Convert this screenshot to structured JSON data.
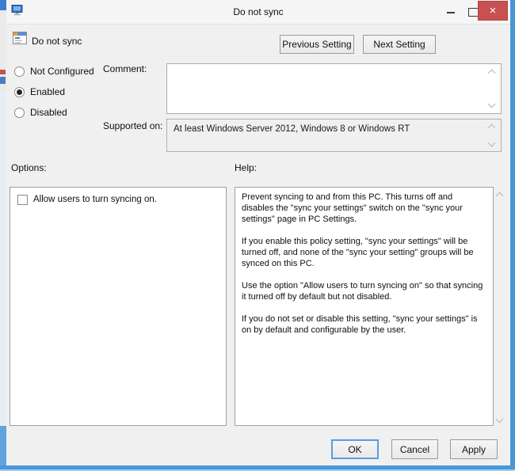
{
  "window": {
    "title": "Do not sync",
    "close_glyph": "×"
  },
  "header": {
    "setting_name": "Do not sync",
    "previous_button": "Previous Setting",
    "next_button": "Next Setting"
  },
  "policy_state": {
    "radios": [
      {
        "label": "Not Configured",
        "selected": false
      },
      {
        "label": "Enabled",
        "selected": true
      },
      {
        "label": "Disabled",
        "selected": false
      }
    ],
    "comment_label": "Comment:",
    "comment_value": "",
    "supported_label": "Supported on:",
    "supported_value": "At least Windows Server 2012, Windows 8 or Windows RT"
  },
  "options": {
    "label": "Options:",
    "checkbox": {
      "label": "Allow users to turn syncing on.",
      "checked": false
    }
  },
  "help": {
    "label": "Help:",
    "paragraphs": [
      "Prevent syncing to and from this PC.  This turns off and disables the \"sync your settings\" switch on the \"sync your settings\" page in PC Settings.",
      "If you enable this policy setting, \"sync your settings\" will be turned off, and none of the \"sync your setting\" groups will be synced on this PC.",
      "Use the option \"Allow users to turn syncing on\" so that syncing it turned off by default but not disabled.",
      "If you do not set or disable this setting, \"sync your settings\" is on by default and configurable by the user."
    ]
  },
  "footer": {
    "ok": "OK",
    "cancel": "Cancel",
    "apply": "Apply"
  },
  "colors": {
    "window_border": "#4897d8",
    "close_button": "#c75050",
    "default_button_border": "#569de5",
    "dialog_background": "#f0f0f0"
  }
}
